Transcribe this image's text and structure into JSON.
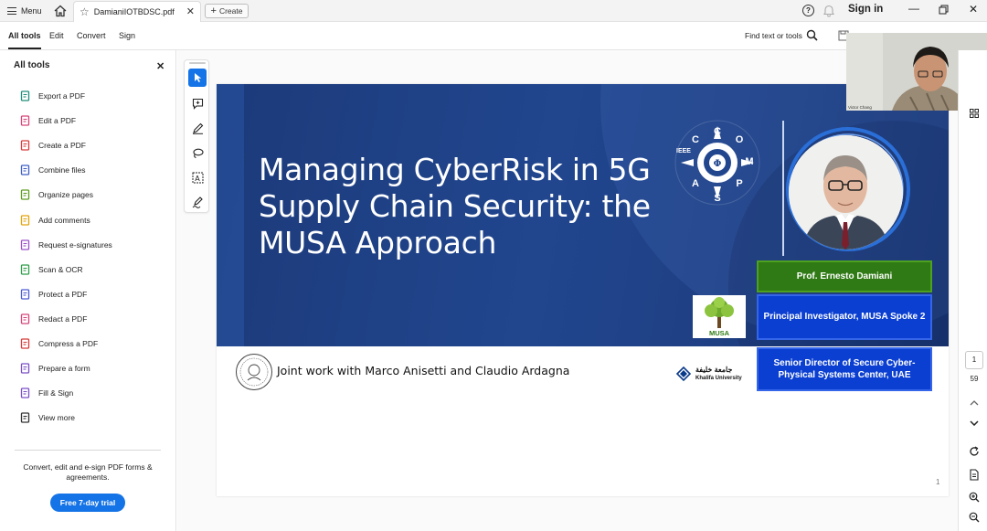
{
  "titlebar": {
    "menu_label": "Menu",
    "tab_name": "DamianiIOTBDSC.pdf",
    "create_label": "Create",
    "signin_label": "Sign in",
    "help_icon": "?"
  },
  "menubar": {
    "items": [
      {
        "label": "All tools"
      },
      {
        "label": "Edit"
      },
      {
        "label": "Convert"
      },
      {
        "label": "Sign"
      }
    ],
    "find_label": "Find text or tools"
  },
  "leftpanel": {
    "title": "All tools",
    "tools": [
      {
        "label": "Export a PDF",
        "icon": "export-pdf-icon",
        "color": "#1e8f7a"
      },
      {
        "label": "Edit a PDF",
        "icon": "edit-pdf-icon",
        "color": "#d8437a"
      },
      {
        "label": "Create a PDF",
        "icon": "create-pdf-icon",
        "color": "#d83b3b"
      },
      {
        "label": "Combine files",
        "icon": "combine-files-icon",
        "color": "#3f5fc7"
      },
      {
        "label": "Organize pages",
        "icon": "organize-pages-icon",
        "color": "#5c9c1f"
      },
      {
        "label": "Add comments",
        "icon": "add-comments-icon",
        "color": "#e2a40c"
      },
      {
        "label": "Request e-signatures",
        "icon": "request-esignatures-icon",
        "color": "#9b4fc8"
      },
      {
        "label": "Scan & OCR",
        "icon": "scan-ocr-icon",
        "color": "#2f9e4a"
      },
      {
        "label": "Protect a PDF",
        "icon": "protect-pdf-icon",
        "color": "#4a5ad4"
      },
      {
        "label": "Redact a PDF",
        "icon": "redact-pdf-icon",
        "color": "#d8437a"
      },
      {
        "label": "Compress a PDF",
        "icon": "compress-pdf-icon",
        "color": "#d83b3b"
      },
      {
        "label": "Prepare a form",
        "icon": "prepare-form-icon",
        "color": "#7a4fc8"
      },
      {
        "label": "Fill & Sign",
        "icon": "fill-sign-icon",
        "color": "#7a4fc8"
      },
      {
        "label": "View more",
        "icon": "view-more-icon",
        "color": "#333333"
      }
    ],
    "promo_text": "Convert, edit and e-sign PDF forms & agreements.",
    "trial_label": "Free 7-day trial"
  },
  "slide": {
    "title": "Managing CyberRisk in 5G Supply Chain Security: the MUSA Approach",
    "presenter_name": "Prof. Ernesto Damiani",
    "role": "Principal Investigator, MUSA Spoke 2",
    "position": "Senior Director of Secure Cyber-Physical Systems Center, UAE",
    "joint_work": "Joint work with Marco Anisetti and Claudio Ardagna",
    "ieee_label": "IEEE",
    "compsac_letters": "COMPSAC",
    "musa_label": "MUSA",
    "khalifa_en": "Khalifa University",
    "khalifa_ar": "جامعة خليفة",
    "page_number": "1"
  },
  "webcam": {
    "participant_label": "Victor Chang"
  },
  "rightrail": {
    "current_page": "1",
    "total_pages": "59"
  },
  "colors": {
    "accent": "#1473e6",
    "slide_bg": "#21468e",
    "name_box": "#2f7a14",
    "role_box": "#0b3fd1"
  }
}
